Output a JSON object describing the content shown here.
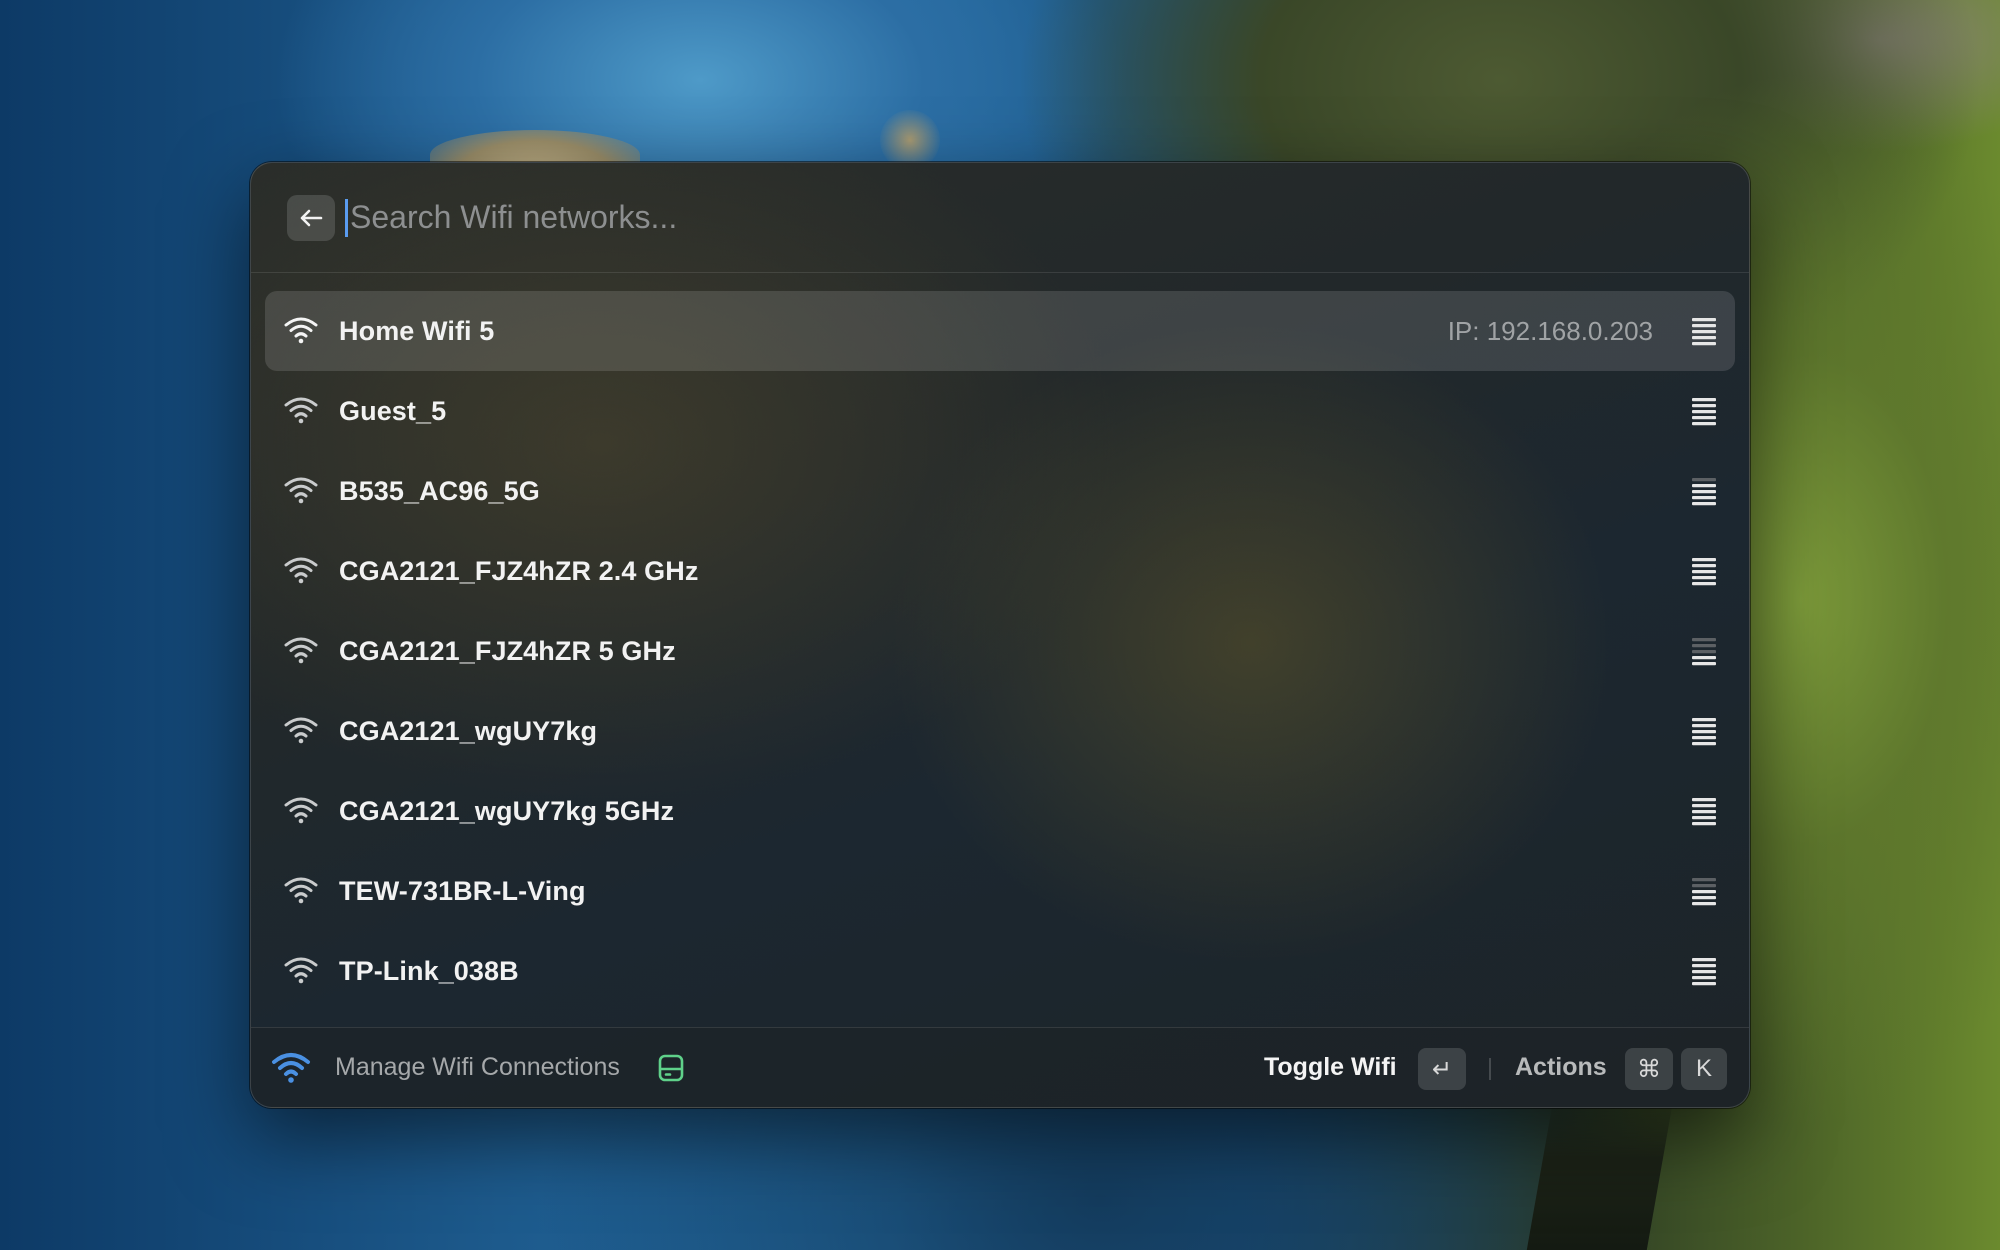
{
  "search": {
    "placeholder": "Search Wifi networks..."
  },
  "networks": [
    {
      "name": "Home Wifi 5",
      "ip": "IP: 192.168.0.203",
      "selected": true,
      "signal_bars": 5,
      "icon": "wifi-icon"
    },
    {
      "name": "Guest_5",
      "ip": "",
      "selected": false,
      "signal_bars": 5,
      "icon": "wifi-icon"
    },
    {
      "name": "B535_AC96_5G",
      "ip": "",
      "selected": false,
      "signal_bars": 4,
      "icon": "wifi-icon"
    },
    {
      "name": "CGA2121_FJZ4hZR 2.4 GHz",
      "ip": "",
      "selected": false,
      "signal_bars": 5,
      "icon": "wifi-icon"
    },
    {
      "name": "CGA2121_FJZ4hZR 5 GHz",
      "ip": "",
      "selected": false,
      "signal_bars": 2,
      "icon": "wifi-icon"
    },
    {
      "name": "CGA2121_wgUY7kg",
      "ip": "",
      "selected": false,
      "signal_bars": 5,
      "icon": "wifi-icon"
    },
    {
      "name": "CGA2121_wgUY7kg 5GHz",
      "ip": "",
      "selected": false,
      "signal_bars": 5,
      "icon": "wifi-icon"
    },
    {
      "name": "TEW-731BR-L-Ving",
      "ip": "",
      "selected": false,
      "signal_bars": 3,
      "icon": "wifi-icon"
    },
    {
      "name": "TP-Link_038B",
      "ip": "",
      "selected": false,
      "signal_bars": 5,
      "icon": "wifi-icon"
    }
  ],
  "footer": {
    "title": "Manage Wifi Connections",
    "primary_action": "Toggle Wifi",
    "enter_key": "↵",
    "actions_label": "Actions",
    "cmd_key": "⌘",
    "k_key": "K"
  },
  "colors": {
    "accent_blue": "#4a90e2",
    "drive_icon_green": "#5fd18a",
    "caret": "#5a9cf0"
  }
}
